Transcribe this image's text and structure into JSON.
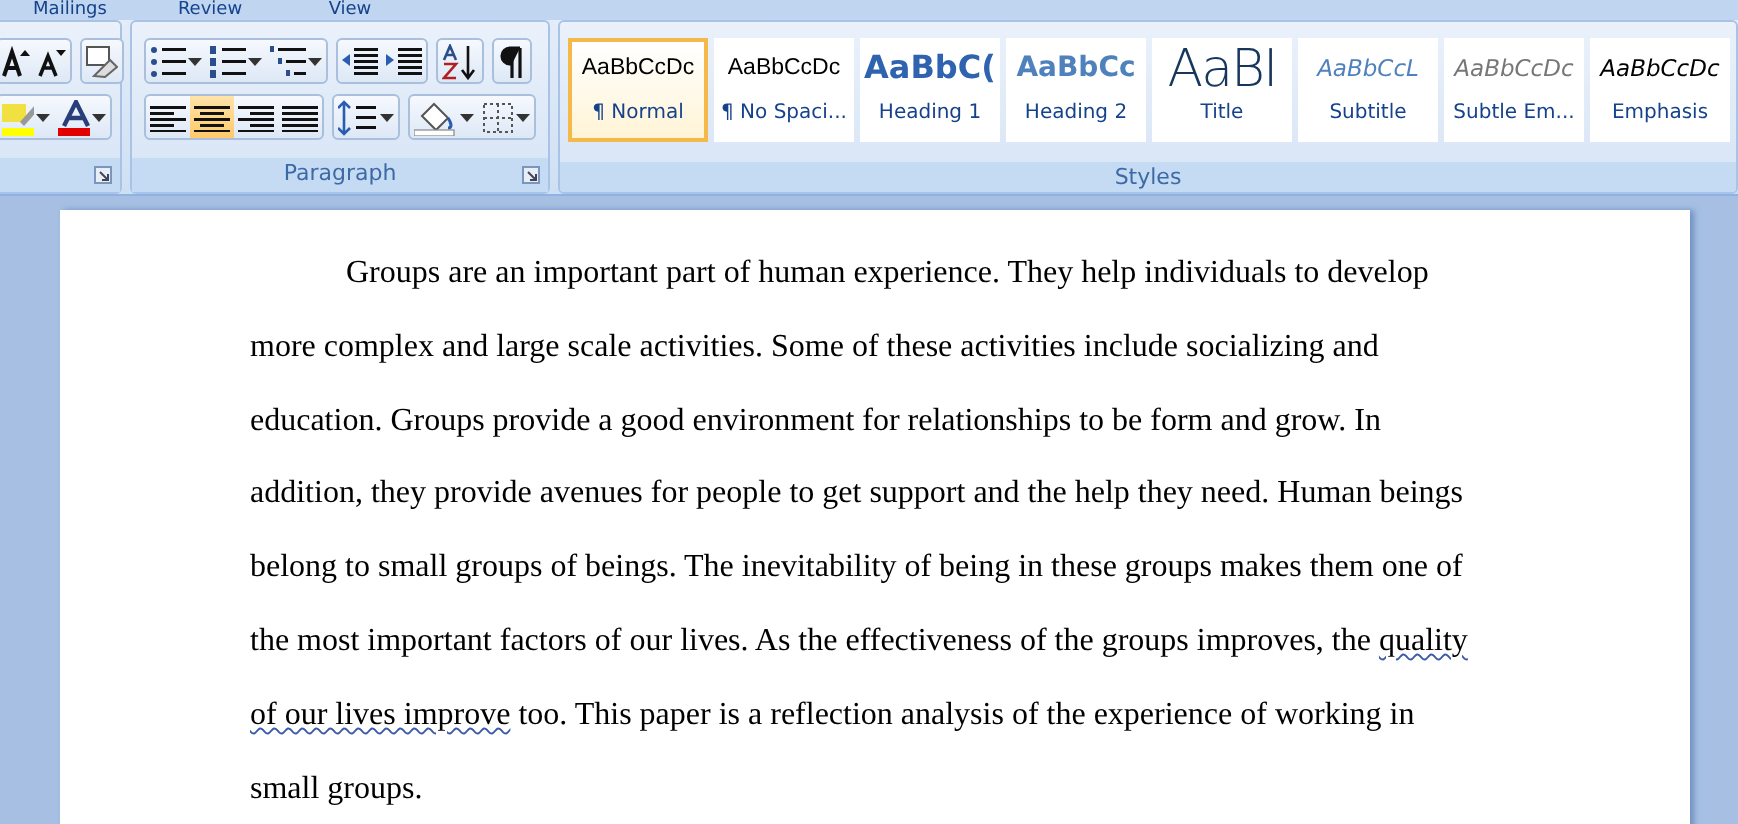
{
  "tabs": [
    {
      "label": "Mailings"
    },
    {
      "label": "Review"
    },
    {
      "label": "View"
    }
  ],
  "paragraph_group": {
    "label": "Paragraph",
    "alignment_buttons": [
      {
        "selected": false
      },
      {
        "selected": true
      },
      {
        "selected": false
      },
      {
        "selected": false
      }
    ]
  },
  "styles_group": {
    "label": "Styles",
    "styles": [
      {
        "preview": "AaBbCcDc",
        "name": "¶ Normal",
        "selected": true,
        "kind": "normal"
      },
      {
        "preview": "AaBbCcDc",
        "name": "¶ No Spaci...",
        "selected": false,
        "kind": "normal"
      },
      {
        "preview": "AaBbC(",
        "name": "Heading 1",
        "selected": false,
        "kind": "heading1"
      },
      {
        "preview": "AaBbCc",
        "name": "Heading 2",
        "selected": false,
        "kind": "heading2"
      },
      {
        "preview": "AaBI",
        "name": "Title",
        "selected": false,
        "kind": "title"
      },
      {
        "preview": "AaBbCcL",
        "name": "Subtitle",
        "selected": false,
        "kind": "subtitle"
      },
      {
        "preview": "AaBbCcDc",
        "name": "Subtle Em...",
        "selected": false,
        "kind": "subtle"
      },
      {
        "preview": "AaBbCcDc",
        "name": "Emphasis",
        "selected": false,
        "kind": "emphasis"
      }
    ]
  },
  "document": {
    "paragraph": [
      {
        "text": "Groups are an important part of human experience. They help individuals to develop more complex and large scale activities. Some of these activities include socializing and education. Groups provide a good environment for relationships to be form and grow. In addition, they provide avenues for people to get support and the help they need. Human beings belong to small groups of beings. The inevitability of being in these groups makes them one of the most important factors of our lives. As the effectiveness of the groups improves, the ",
        "flagged": false
      },
      {
        "text": "quality of our lives improve",
        "flagged": true
      },
      {
        "text": " too. This paper is a reflection analysis of the experience of working in small groups.",
        "flagged": false
      }
    ]
  }
}
